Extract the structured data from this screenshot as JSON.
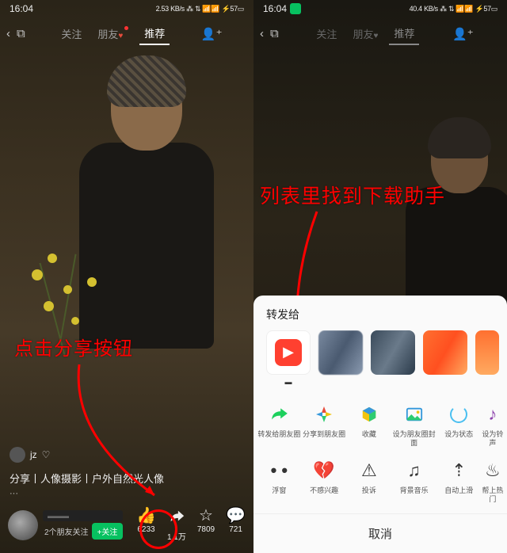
{
  "status": {
    "time": "16:04",
    "speed_l": "2.53 KB/s",
    "speed_r": "40.4 KB/s",
    "battery": "57"
  },
  "tabs": {
    "follow": "关注",
    "friends": "朋友",
    "recommend": "推荐"
  },
  "left": {
    "annotation": "点击分享按钮",
    "user": "jz",
    "caption": "分享丨人像摄影丨户外自然光人像",
    "follow_count": "2个朋友关注",
    "follow_btn": "+关注",
    "actions": {
      "like": "6233",
      "share": "1.1万",
      "star": "7809",
      "comment": "721"
    }
  },
  "right": {
    "annotation": "列表里找到下载助手",
    "sheet_title": "转发给",
    "row1": [
      {
        "label": "转发给朋友圈"
      },
      {
        "label": "分享到朋友圈"
      },
      {
        "label": "收藏"
      },
      {
        "label": "设为朋友圈封面"
      },
      {
        "label": "设为状态"
      },
      {
        "label": "设为铃声"
      }
    ],
    "row2": [
      {
        "label": "浮窗"
      },
      {
        "label": "不感兴趣"
      },
      {
        "label": "投诉"
      },
      {
        "label": "背景音乐"
      },
      {
        "label": "自动上滑"
      },
      {
        "label": "帮上热门"
      }
    ],
    "cancel": "取消"
  }
}
